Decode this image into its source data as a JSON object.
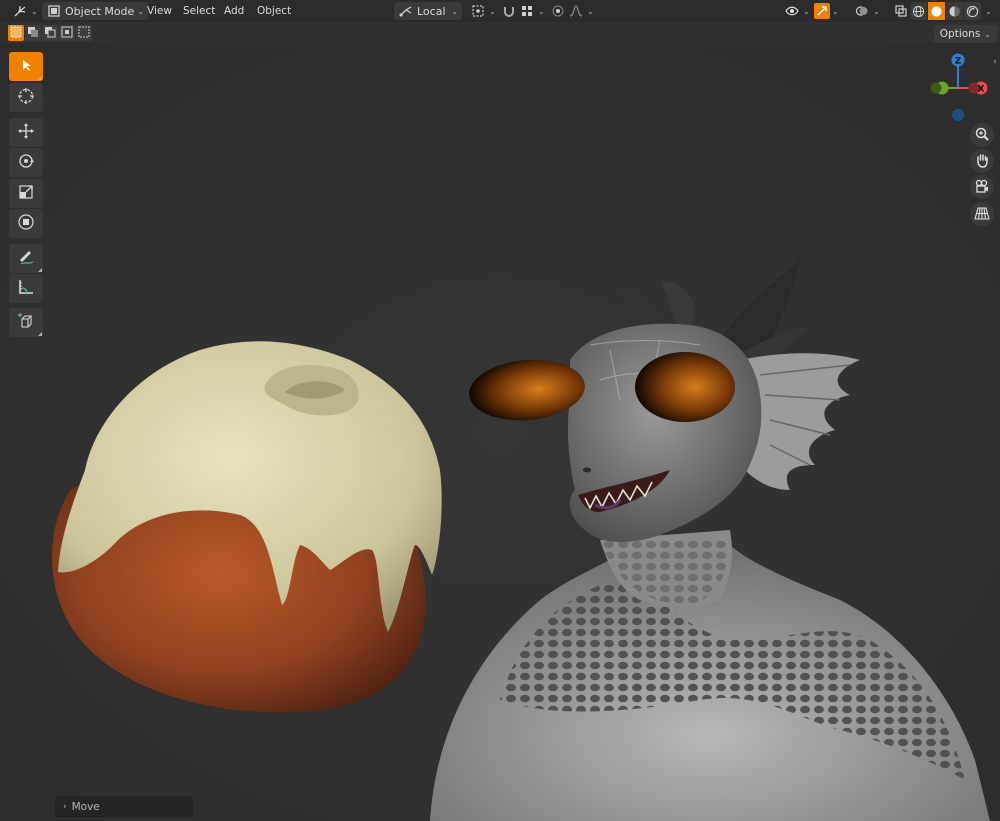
{
  "header": {
    "mode_label": "Object Mode",
    "menus": [
      "View",
      "Select",
      "Add",
      "Object"
    ],
    "transform_orientation": "Local",
    "colors": {
      "bar": "#2b2b2b",
      "accent": "#f08200",
      "button": "#3a3a3a"
    }
  },
  "options_label": "Options",
  "toolbar": {
    "tools": [
      {
        "icon": "select-box-icon",
        "active": true
      },
      {
        "icon": "cursor-icon",
        "active": false
      },
      {
        "icon": "move-icon",
        "active": false
      },
      {
        "icon": "rotate-icon",
        "active": false
      },
      {
        "icon": "scale-icon",
        "active": false
      },
      {
        "icon": "transform-icon",
        "active": false
      },
      {
        "icon": "annotate-icon",
        "active": false
      },
      {
        "icon": "measure-icon",
        "active": false
      },
      {
        "icon": "add-cube-icon",
        "active": false
      }
    ]
  },
  "gizmo": {
    "z_label": "Z",
    "x_label": "X",
    "colors": {
      "x": "#e44d4d",
      "y": "#6ea52a",
      "z": "#2e7fd3"
    }
  },
  "nav_buttons": [
    "zoom-icon",
    "pan-hand-icon",
    "camera-icon",
    "grid-perspective-icon"
  ],
  "operator_panel": {
    "label": "Move"
  }
}
